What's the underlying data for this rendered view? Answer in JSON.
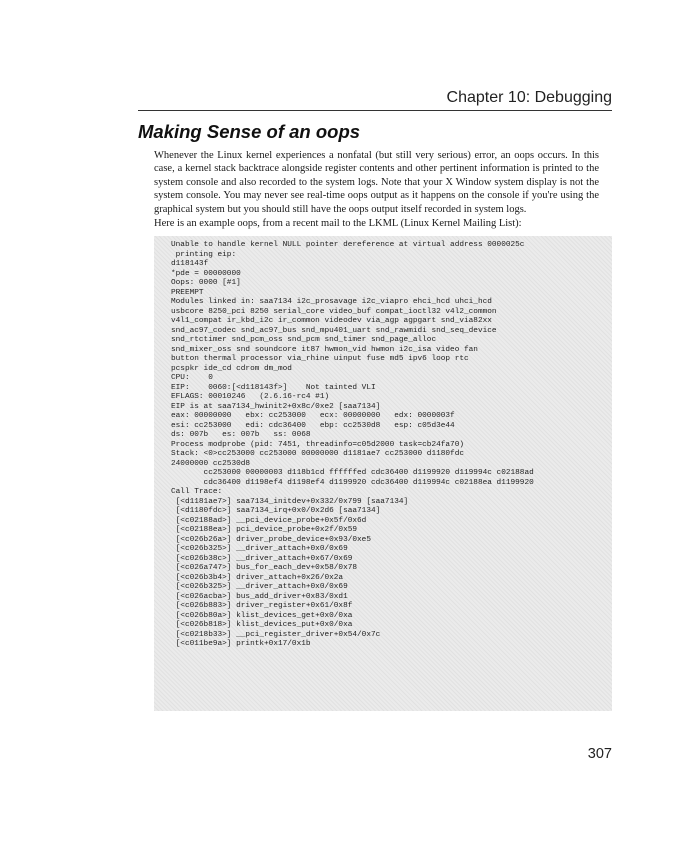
{
  "header": {
    "chapter_title": "Chapter 10: Debugging"
  },
  "section": {
    "title": "Making Sense of an oops"
  },
  "paragraphs": {
    "intro": "Whenever the Linux kernel experiences a nonfatal (but still very serious) error, an oops occurs. In this case, a kernel stack backtrace alongside register contents and other pertinent information is printed to the system console and also recorded to the system logs. Note that your X Window system display is not the system console. You may never see real-time oops output as it happens on the console if you're using the graphical system but you should still have the oops output itself recorded in system logs.",
    "example_intro": "Here is an example oops, from a recent mail to the LKML (Linux Kernel Mailing List):"
  },
  "code_lines": [
    "Unable to handle kernel NULL pointer dereference at virtual address 0000025c",
    " printing eip:",
    "d118143f",
    "*pde = 00000000",
    "Oops: 0000 [#1]",
    "PREEMPT",
    "Modules linked in: saa7134 i2c_prosavage i2c_viapro ehci_hcd uhci_hcd",
    "usbcore 8250_pci 8250 serial_core video_buf compat_ioctl32 v4l2_common",
    "v4l1_compat ir_kbd_i2c ir_common videodev via_agp agpgart snd_via82xx",
    "snd_ac97_codec snd_ac97_bus snd_mpu401_uart snd_rawmidi snd_seq_device",
    "snd_rtctimer snd_pcm_oss snd_pcm snd_timer snd_page_alloc",
    "snd_mixer_oss snd soundcore it87 hwmon_vid hwmon i2c_isa video fan",
    "button thermal processor via_rhine uinput fuse md5 ipv6 loop rtc",
    "pcspkr ide_cd cdrom dm_mod",
    "CPU:    0",
    "EIP:    0060:[<d118143f>]    Not tainted VLI",
    "EFLAGS: 00010246   (2.6.16-rc4 #1)",
    "EIP is at saa7134_hwinit2+0x8c/0xe2 [saa7134]",
    "eax: 00000000   ebx: cc253000   ecx: 00000000   edx: 0000003f",
    "esi: cc253000   edi: cdc36400   ebp: cc2530d8   esp: c05d3e44",
    "ds: 007b   es: 007b   ss: 0068",
    "Process modprobe (pid: 7451, threadinfo=c05d2000 task=cb24fa70)",
    "Stack: <0>cc253000 cc253000 00000000 d1181ae7 cc253000 d1180fdc",
    "24000000 cc2530d8",
    "       cc253000 00000003 d118b1cd ffffffed cdc36400 d1199920 d119994c c02188ad",
    "       cdc36400 d1198ef4 d1198ef4 d1199920 cdc36400 d119994c c02188ea d1199920",
    "Call Trace:",
    " [<d1181ae7>] saa7134_initdev+0x332/0x799 [saa7134]",
    " [<d1180fdc>] saa7134_irq+0x0/0x2d6 [saa7134]",
    " [<c02188ad>] __pci_device_probe+0x5f/0x6d",
    " [<c02188ea>] pci_device_probe+0x2f/0x59",
    " [<c026b26a>] driver_probe_device+0x93/0xe5",
    " [<c026b325>] __driver_attach+0x0/0x69",
    " [<c026b38c>] __driver_attach+0x67/0x69",
    " [<c026a747>] bus_for_each_dev+0x58/0x78",
    " [<c026b3b4>] driver_attach+0x26/0x2a",
    " [<c026b325>] __driver_attach+0x0/0x69",
    " [<c026acba>] bus_add_driver+0x83/0xd1",
    " [<c026b883>] driver_register+0x61/0x8f",
    " [<c026b80a>] klist_devices_get+0x0/0xa",
    " [<c026b818>] klist_devices_put+0x0/0xa",
    " [<c0218b33>] __pci_register_driver+0x54/0x7c",
    " [<c011be9a>] printk+0x17/0x1b"
  ],
  "footer": {
    "page_number": "307"
  }
}
